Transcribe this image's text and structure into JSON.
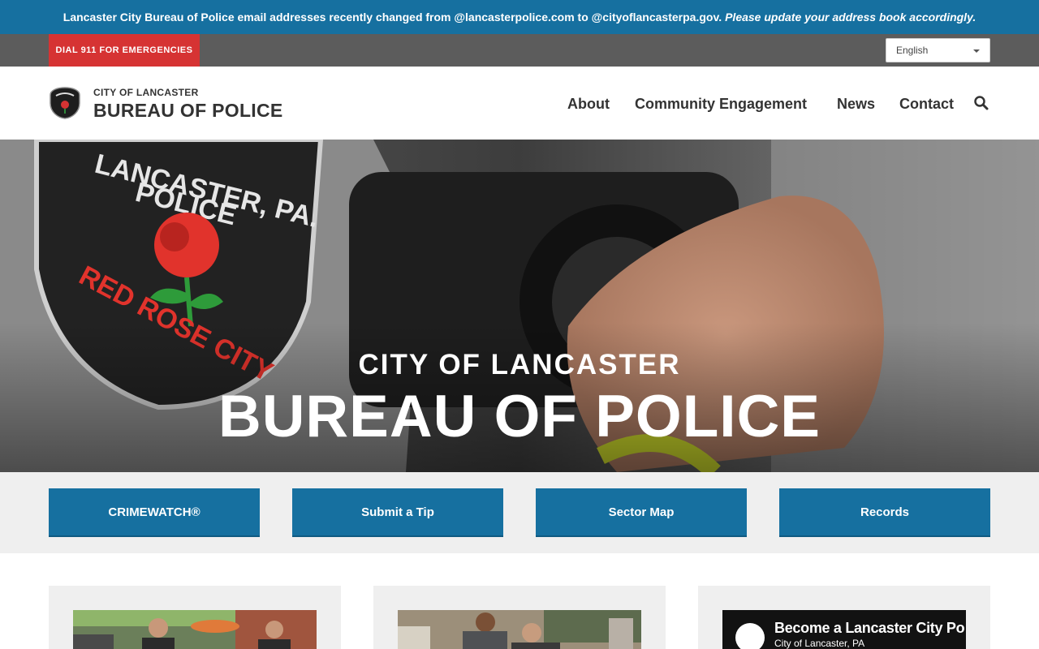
{
  "alert": {
    "text": "Lancaster City Bureau of Police email addresses recently changed from @lancasterpolice.com to @cityoflancasterpa.gov.",
    "emphasis": "Please update your address book accordingly."
  },
  "utility": {
    "emergency_label": "DIAL 911 FOR EMERGENCIES",
    "language_value": "English"
  },
  "header": {
    "brand_small": "CITY OF LANCASTER",
    "brand_big": "BUREAU OF POLICE",
    "nav": [
      "About",
      "Community Engagement",
      "News",
      "Contact"
    ],
    "search_icon": "search-icon"
  },
  "hero": {
    "subtitle": "CITY OF LANCASTER",
    "title": "BUREAU OF POLICE"
  },
  "quick_links": [
    "CRIMEWATCH®",
    "Submit a Tip",
    "Sector Map",
    "Records"
  ],
  "video": {
    "title": "Become a Lancaster City Po",
    "subtitle": "City of Lancaster, PA"
  },
  "colors": {
    "primary_blue": "#1670a0",
    "emergency_red": "#d63333",
    "utility_gray": "#5c5c5c"
  }
}
